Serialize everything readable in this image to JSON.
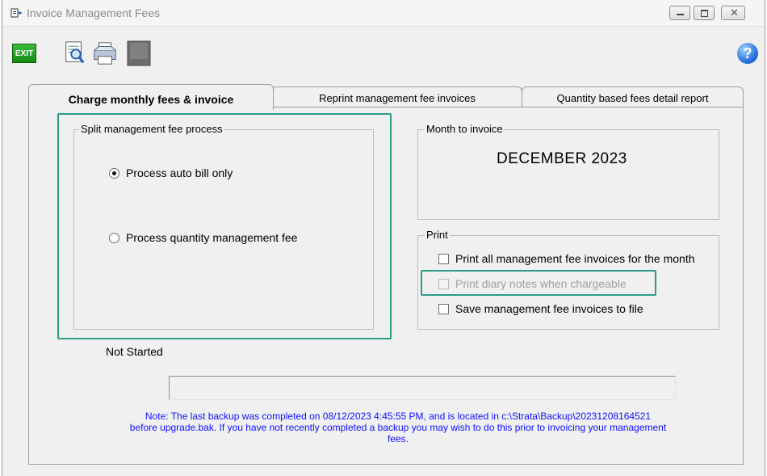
{
  "window": {
    "title": "Invoice Management Fees"
  },
  "toolbar": {
    "exit_label": "EXIT",
    "help_label": "?"
  },
  "tabs": [
    {
      "label": "Charge monthly fees & invoice",
      "active": true
    },
    {
      "label": "Reprint management fee invoices",
      "active": false
    },
    {
      "label": "Quantity based fees detail report",
      "active": false
    }
  ],
  "split_group": {
    "legend": "Split management fee process",
    "options": [
      {
        "label": "Process auto bill only",
        "selected": true
      },
      {
        "label": "Process quantity management fee",
        "selected": false
      }
    ]
  },
  "month_group": {
    "legend": "Month to invoice",
    "value": "DECEMBER 2023"
  },
  "print_group": {
    "legend": "Print",
    "options": [
      {
        "label": "Print all management fee invoices for the month",
        "checked": false,
        "enabled": true
      },
      {
        "label": "Print diary notes when chargeable",
        "checked": false,
        "enabled": false
      },
      {
        "label": "Save management fee invoices to file",
        "checked": false,
        "enabled": true
      }
    ]
  },
  "status": "Not Started",
  "progress": 0,
  "note": {
    "line1": "Note: The last backup was completed on 08/12/2023 4:45:55 PM, and is located in c:\\Strata\\Backup\\20231208164521",
    "line2": "before upgrade.bak. If you have not recently completed a backup you may wish to do this prior to invoicing your management",
    "line3": "fees."
  },
  "colors": {
    "highlight": "#2b9c86",
    "note_text": "#1010ff"
  }
}
